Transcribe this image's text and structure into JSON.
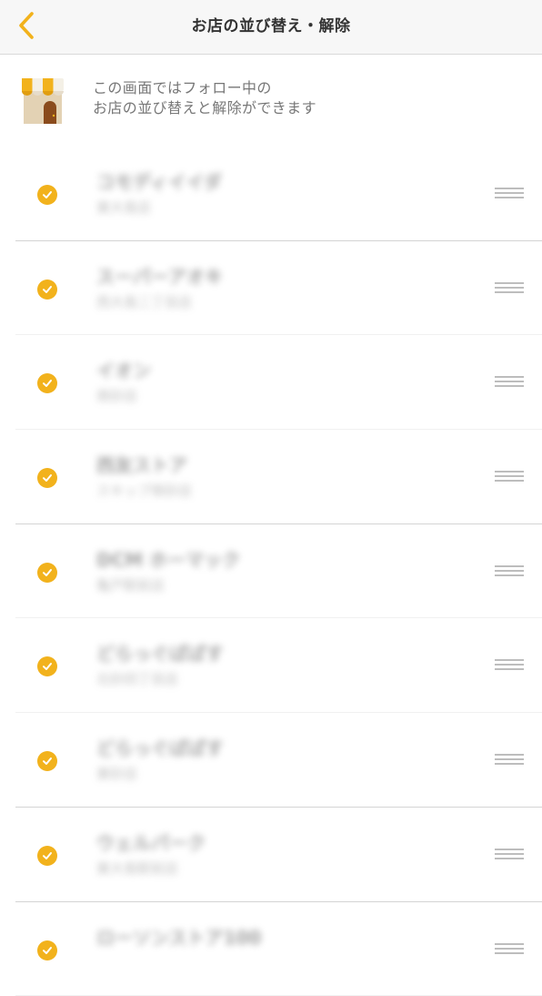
{
  "header": {
    "title": "お店の並び替え・解除",
    "back_icon": "chevron-left-icon"
  },
  "intro": {
    "icon": "shop-icon",
    "line1": "この画面ではフォロー中の",
    "line2": "お店の並び替えと解除ができます"
  },
  "colors": {
    "accent": "#f2b21c",
    "header_bg": "#f7f7f7",
    "divider": "#d4d4d4",
    "intro_text": "#777777"
  },
  "shops": [
    {
      "name": "コモディイイダ",
      "sub": "東大島店",
      "checked": true
    },
    {
      "name": "スーパーアオキ",
      "sub": "西大島二丁目店",
      "checked": true
    },
    {
      "name": "イオン",
      "sub": "南砂店",
      "checked": true
    },
    {
      "name": "西友ストア",
      "sub": "スキップ南砂店",
      "checked": true
    },
    {
      "name": "DCM ホーマック",
      "sub": "亀戸駅前店",
      "checked": true
    },
    {
      "name": "どらっぐぱぱす",
      "sub": "北砂四丁目店",
      "checked": true
    },
    {
      "name": "どらっぐぱぱす",
      "sub": "東砂店",
      "checked": true
    },
    {
      "name": "ウェルパーク",
      "sub": "東大島駅前店",
      "checked": true
    },
    {
      "name": "ローソンストア100",
      "sub": "",
      "checked": true
    }
  ]
}
